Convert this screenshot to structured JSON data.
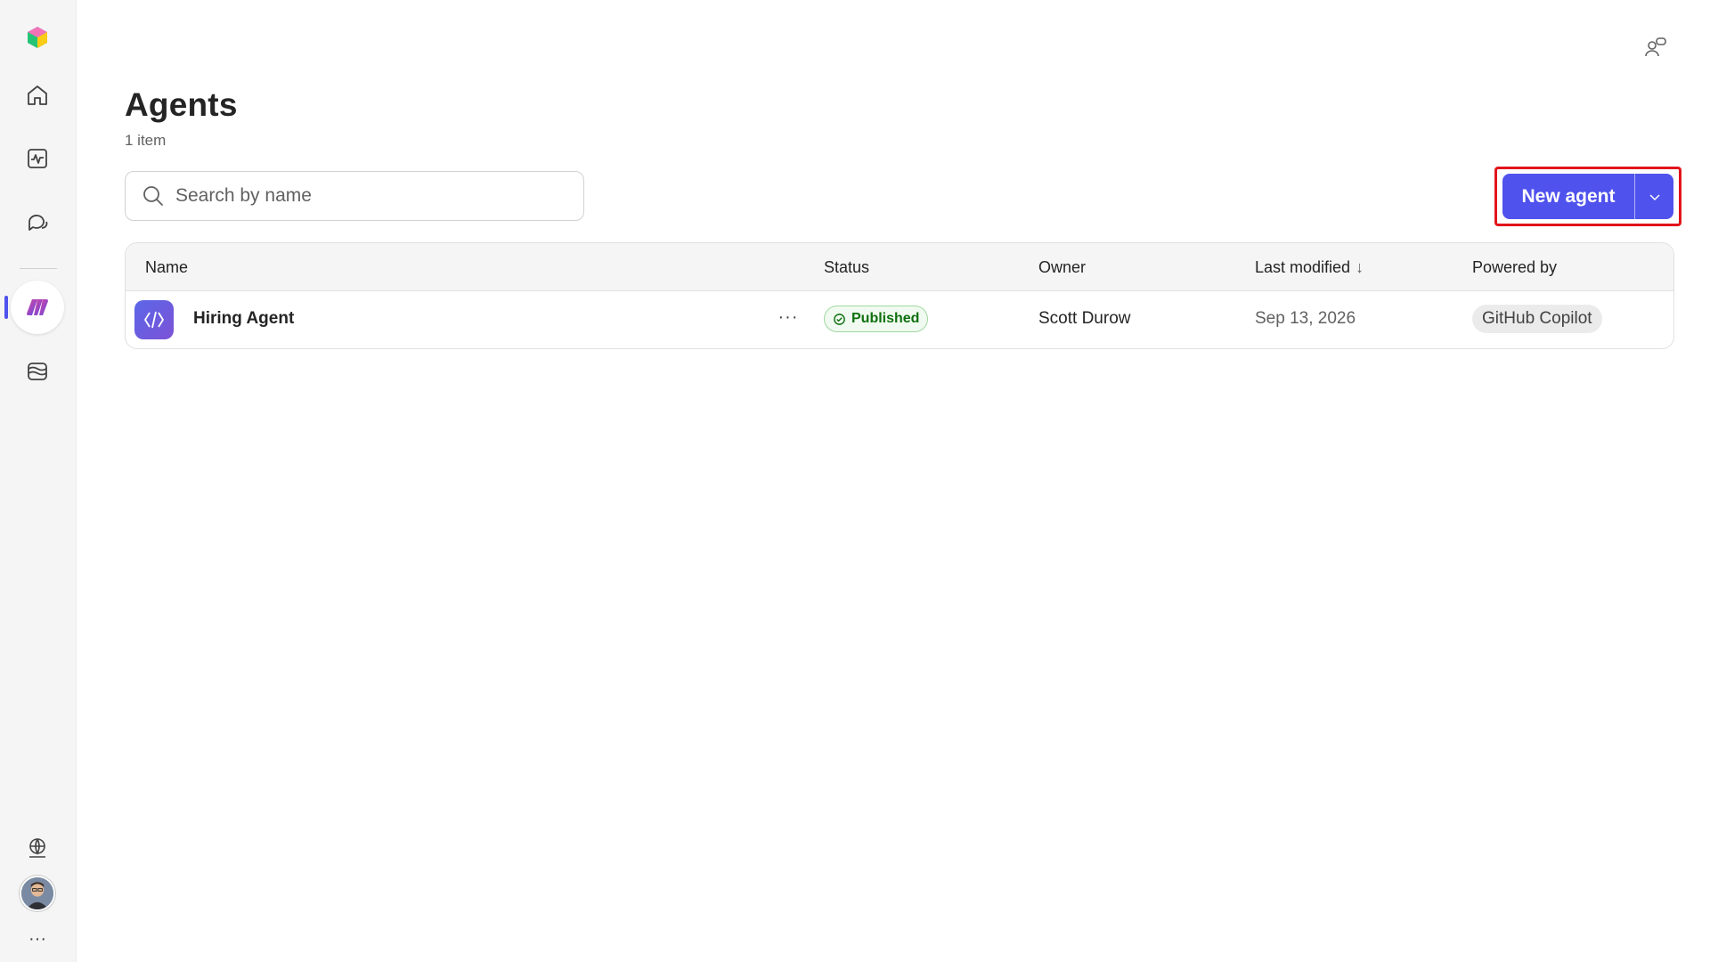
{
  "rail": {
    "items": [
      {
        "name": "app-logo",
        "icon": "copilot-logo-icon"
      },
      {
        "name": "home",
        "icon": "home-icon"
      },
      {
        "name": "monitor",
        "icon": "activity-icon"
      },
      {
        "name": "chat",
        "icon": "chat-bubbles-icon"
      },
      {
        "name": "agents",
        "icon": "agents-icon",
        "active": true
      },
      {
        "name": "library",
        "icon": "library-icon"
      }
    ],
    "bottom": [
      {
        "name": "environment",
        "icon": "globe-network-icon"
      },
      {
        "name": "profile",
        "icon": "avatar"
      },
      {
        "name": "more",
        "icon": "more-horizontal-icon",
        "label": "···"
      }
    ],
    "accent": "#4f52ec"
  },
  "header": {
    "title": "Agents",
    "count": "1 item",
    "top_right_icon": "share-people-icon"
  },
  "search": {
    "placeholder": "Search by name",
    "value": ""
  },
  "toolbar": {
    "new_agent_label": "New agent",
    "accent": "#4f52ec",
    "highlight_color": "#e3141b"
  },
  "table": {
    "columns": [
      "Name",
      "Status",
      "Owner",
      "Last modified",
      "Powered by"
    ],
    "sort_indicator": "↓",
    "rows": [
      {
        "name": "Hiring Agent",
        "more": "···",
        "status": "Published",
        "owner": "Scott Durow",
        "last_modified": "Sep 13, 2026",
        "powered_by": "GitHub Copilot"
      }
    ]
  }
}
